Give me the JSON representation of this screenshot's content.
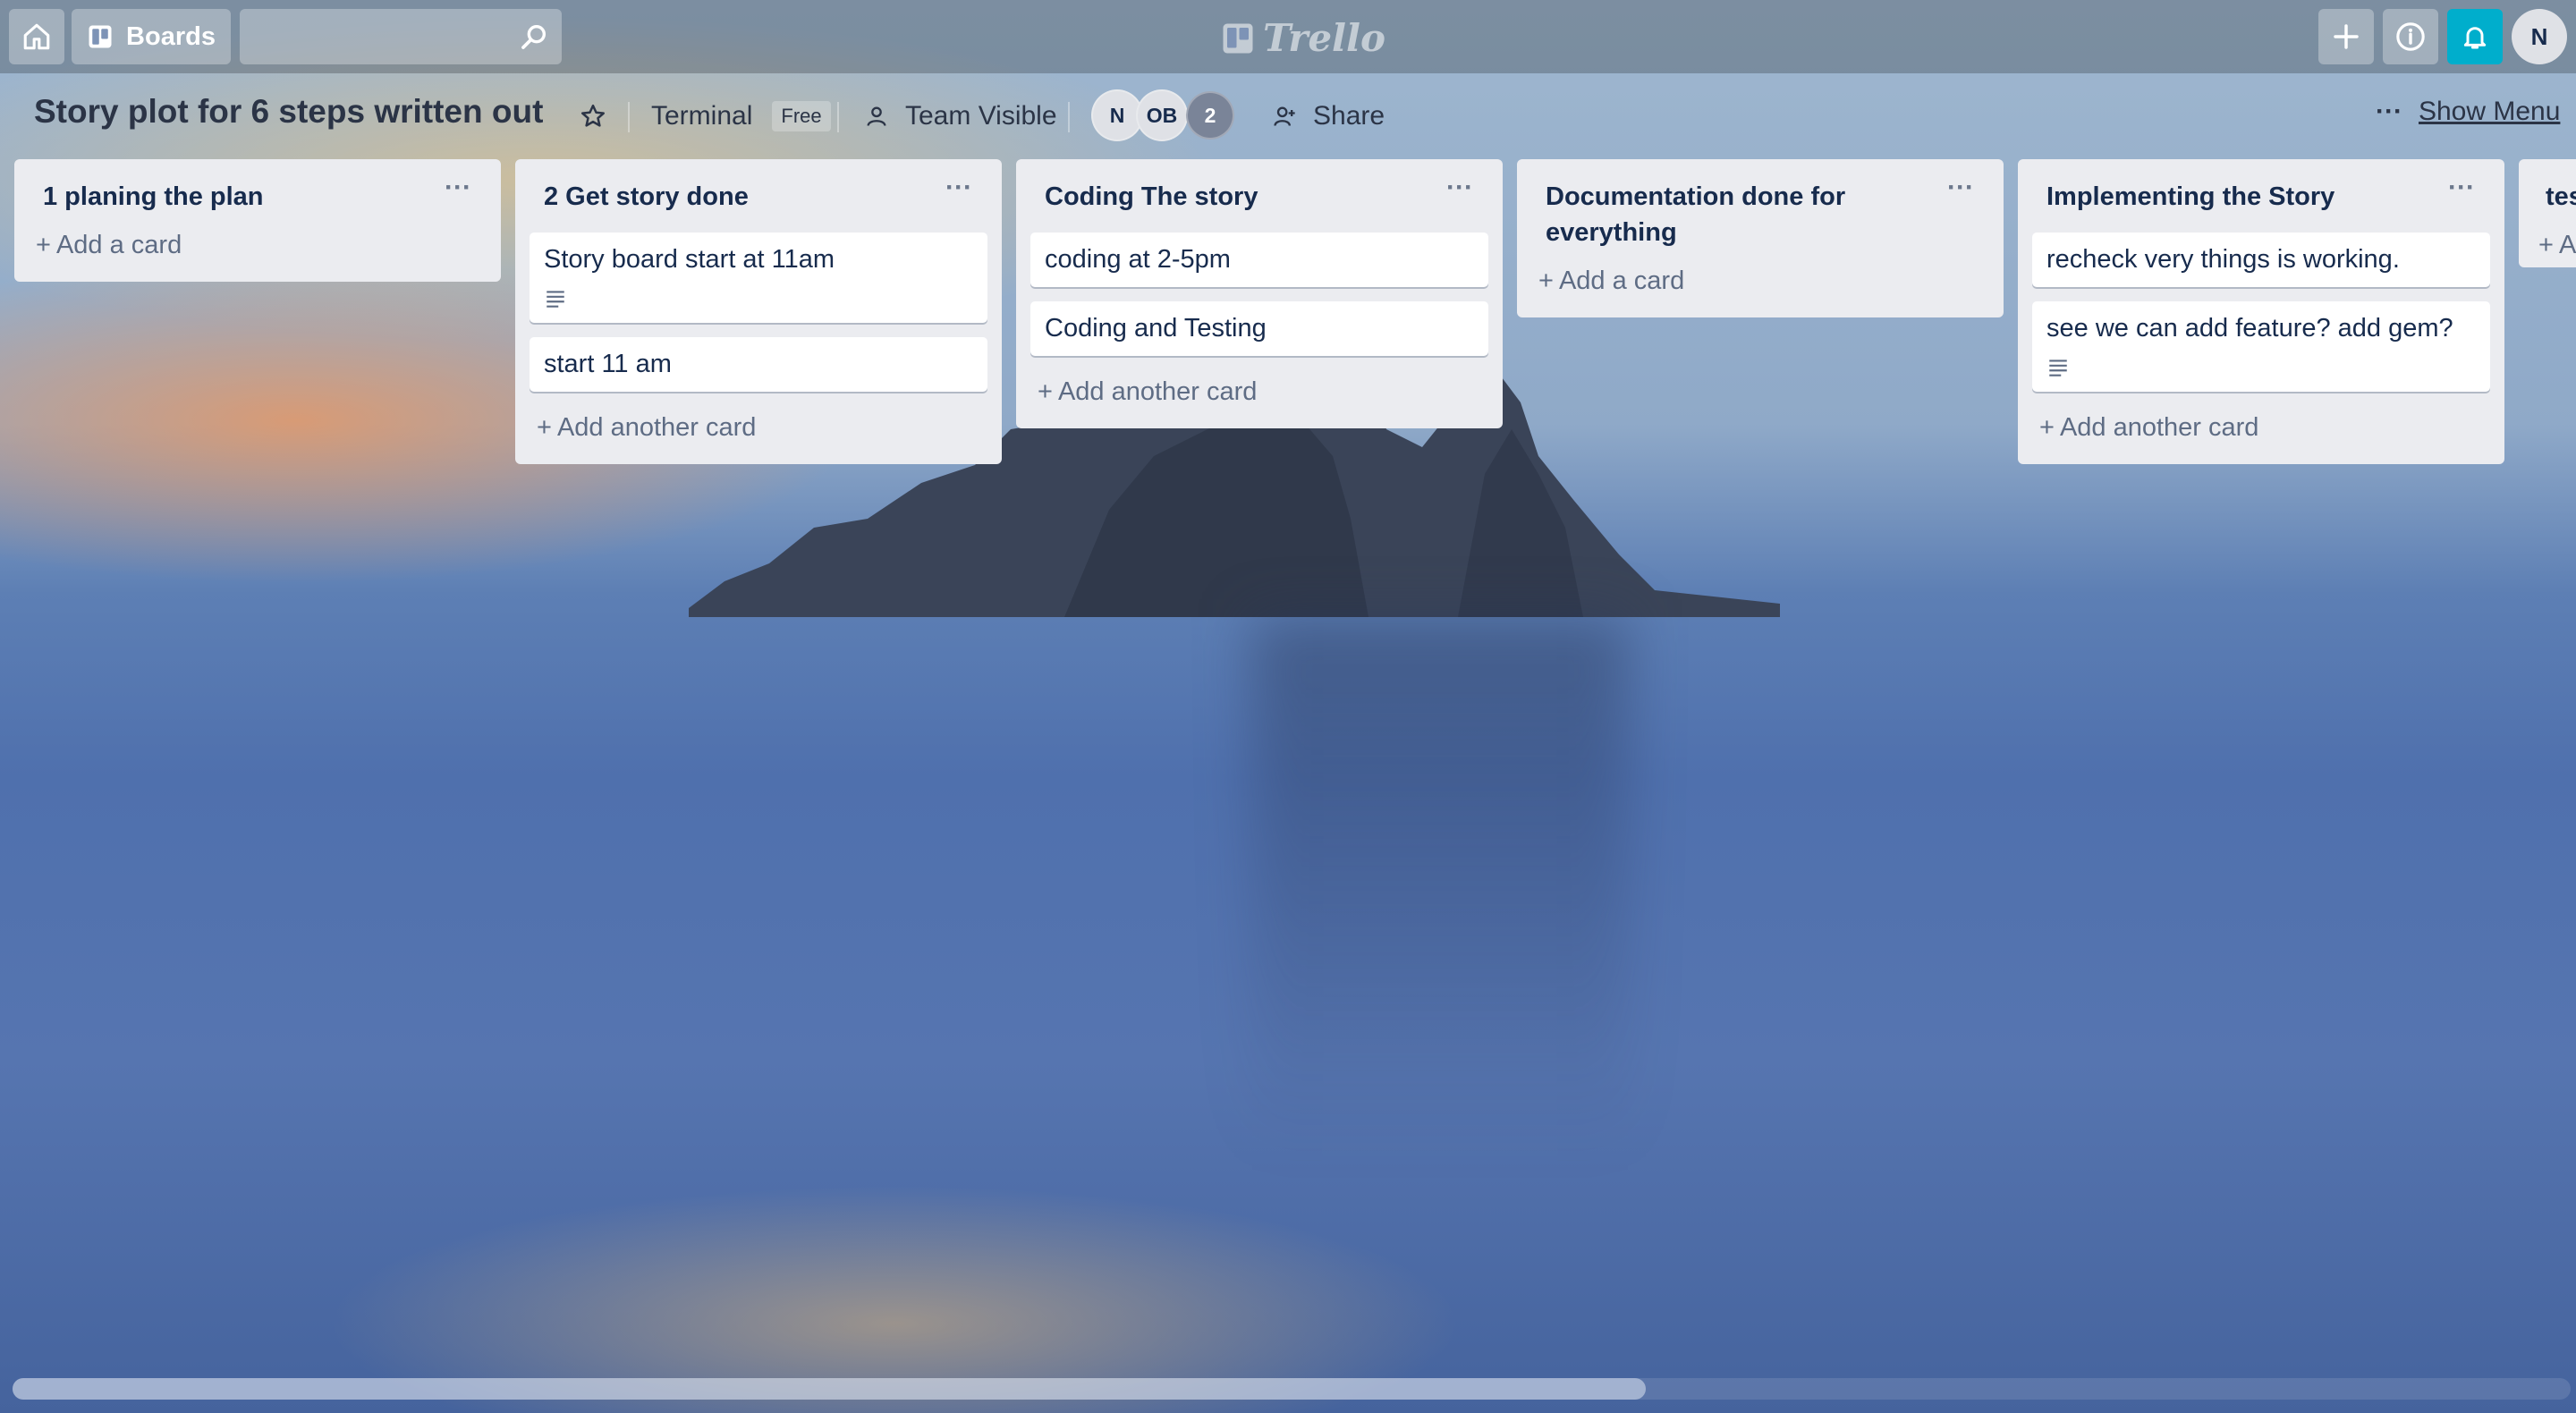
{
  "topbar": {
    "boards_label": "Boards",
    "search_value": "",
    "logo_text": "Trello",
    "avatar_initial": "N"
  },
  "board": {
    "title": "Story plot for 6 steps written out",
    "team": "Terminal",
    "plan_badge": "Free",
    "visibility": "Team Visible",
    "members": [
      "N",
      "OB"
    ],
    "more_members_count": "2",
    "share_label": "Share",
    "show_menu_label": "Show Menu"
  },
  "lists": [
    {
      "title": "1 planing the plan",
      "cards": [],
      "add_label": "Add a card"
    },
    {
      "title": "2 Get story done",
      "cards": [
        {
          "text": "Story board start at 11am",
          "has_description": true
        },
        {
          "text": "start 11 am",
          "has_description": false
        }
      ],
      "add_label": "Add another card"
    },
    {
      "title": "Coding The story",
      "cards": [
        {
          "text": "coding at 2-5pm",
          "has_description": false
        },
        {
          "text": "Coding and Testing",
          "has_description": false
        }
      ],
      "add_label": "Add another card"
    },
    {
      "title": "Documentation done for everything",
      "cards": [],
      "add_label": "Add a card"
    },
    {
      "title": "Implementing the Story",
      "cards": [
        {
          "text": "recheck very things is working.",
          "has_description": false
        },
        {
          "text": "see we can add feature? add gem?",
          "has_description": true
        }
      ],
      "add_label": "Add another card"
    },
    {
      "title": "tes",
      "cards": [],
      "add_label": "A"
    }
  ],
  "icons": {
    "home": "home-icon",
    "boards": "board-icon",
    "search": "search-icon",
    "add": "plus-icon",
    "info": "info-icon",
    "notifications": "bell-icon",
    "star": "star-icon",
    "visibility": "team-icon",
    "share": "share-icon",
    "description": "description-icon",
    "list_menu": "ellipsis-icon"
  },
  "colors": {
    "notification_button": "#00aecc",
    "list_background": "#ebecf0",
    "card_text": "#172b4d"
  }
}
